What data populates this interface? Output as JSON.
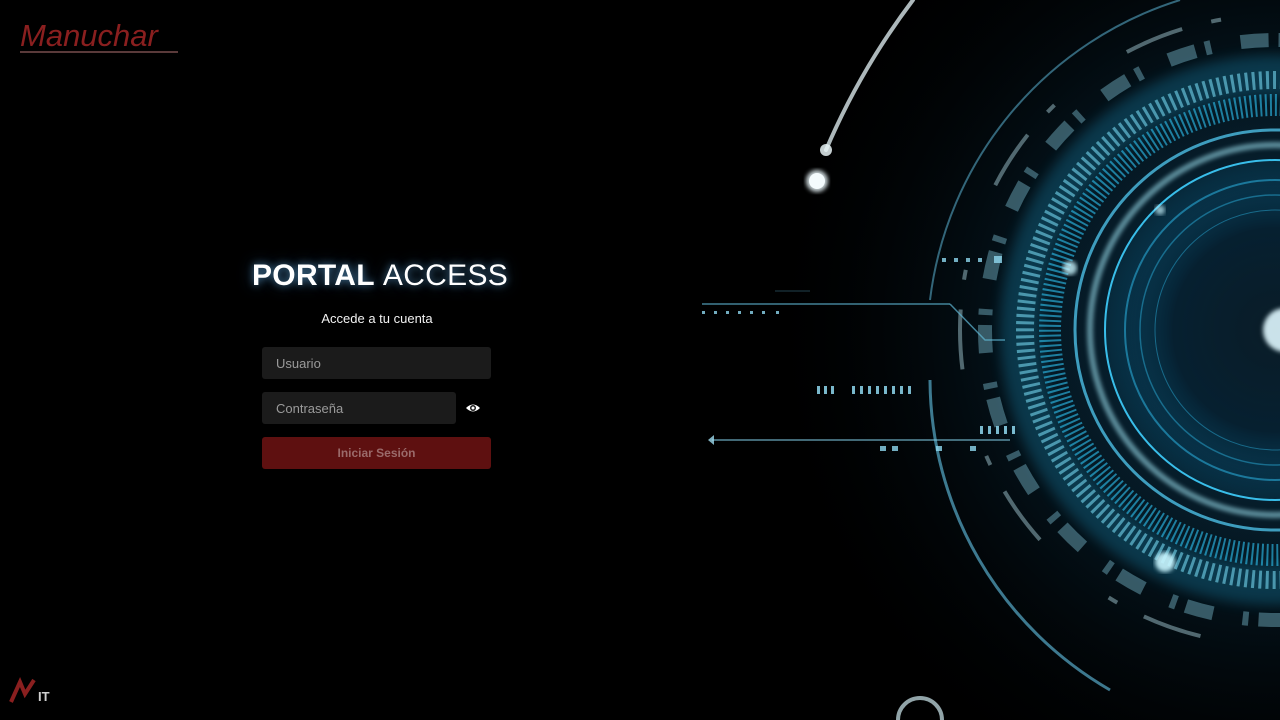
{
  "brand": {
    "logo_text": "Manuchar",
    "footer_logo_text": "MIT"
  },
  "login": {
    "title_bold": "PORTAL",
    "title_light": "ACCESS",
    "subtitle": "Accede a tu cuenta",
    "username_placeholder": "Usuario",
    "password_placeholder": "Contraseña",
    "submit_label": "Iniciar Sesión"
  },
  "icons": {
    "toggle_password": "eye-icon"
  },
  "colors": {
    "background": "#000000",
    "accent_red": "#8b1a1a",
    "button_bg": "#5e1010",
    "field_bg": "#1b1b1b",
    "tech_cyan": "#3fd0ff"
  }
}
